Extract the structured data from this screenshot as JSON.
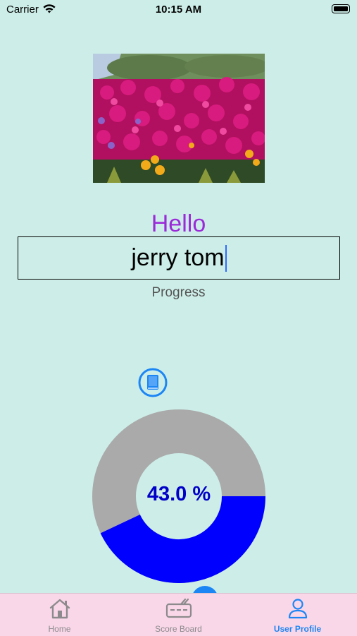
{
  "status_bar": {
    "carrier": "Carrier",
    "time": "10:15 AM"
  },
  "profile": {
    "greeting": "Hello",
    "name_value": "jerry tom",
    "progress_label": "Progress"
  },
  "progress": {
    "percent_text": "43.0 %",
    "fraction": 0.43,
    "complete_color": "#0000ff",
    "remaining_color": "#aaaaaa"
  },
  "colors": {
    "background": "#cdeee8",
    "greeting": "#9b2bd8",
    "accent": "#1d86f5",
    "tab_bar": "#f9d7e8"
  },
  "tab_bar": {
    "tabs": [
      {
        "label": "Home",
        "icon": "house-icon",
        "active": false
      },
      {
        "label": "Score Board",
        "icon": "scoreboard-icon",
        "active": false
      },
      {
        "label": "User Profile",
        "icon": "person-icon",
        "active": true
      }
    ]
  },
  "icons": {
    "book_button": "book-icon",
    "photo": "flower-photo"
  }
}
